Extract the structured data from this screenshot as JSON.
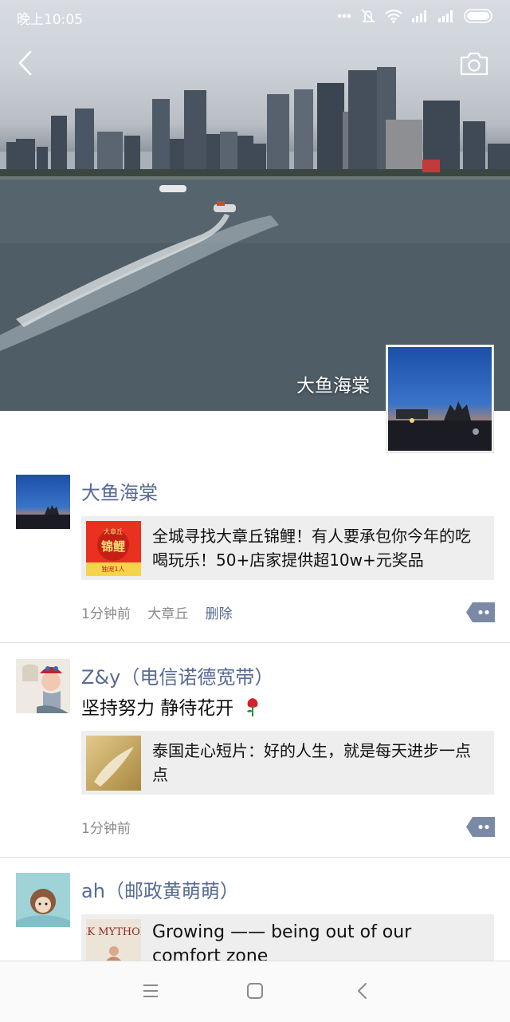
{
  "status_bar": {
    "time": "晚上10:05",
    "icons": [
      "more-dots-icon",
      "mute-icon",
      "wifi-icon",
      "signal-icon",
      "signal-icon",
      "battery-icon"
    ]
  },
  "cover": {
    "user_name": "大鱼海棠"
  },
  "posts": [
    {
      "name": "大鱼海棠",
      "share": {
        "title": "全城寻找大章丘锦鲤！有人要承包你今年的吃喝玩乐！50+店家提供超10w+元奖品",
        "thumb_caption_top": "大章丘",
        "thumb_caption_main": "锦鲤",
        "thumb_caption_bottom": "独宠1人"
      },
      "time": "1分钟前",
      "location": "大章丘",
      "delete_label": "删除"
    },
    {
      "name": "Z&y（电信诺德宽带）",
      "text": "坚持努力  静待花开",
      "share": {
        "title": "泰国走心短片：好的人生，就是每天进步一点点"
      },
      "time": "1分钟前"
    },
    {
      "name": "ah（邮政黄萌萌）",
      "share": {
        "title": "Growing —— being out of our comfort zone",
        "thumb_caption": "GREEK MYTHOLOGY"
      }
    }
  ],
  "colors": {
    "link_blue": "#576b95",
    "share_bg": "#eeeeee",
    "meta_gray": "#8a8a8a"
  }
}
